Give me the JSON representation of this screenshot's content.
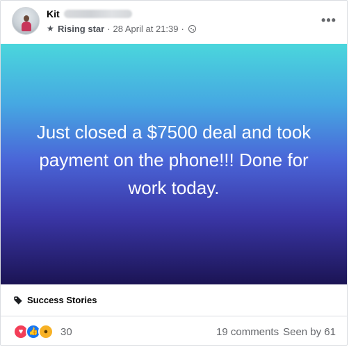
{
  "post": {
    "author": "Kit",
    "badge": "Rising star",
    "timestamp": "28 April at 21:39",
    "separator": "·",
    "more_label": "•••",
    "media_text": "Just closed a $7500 deal and took payment on the phone!!! Done for work today.",
    "topic_tag": "Success Stories",
    "reaction_count": "30",
    "comments": "19 comments",
    "seen_by": "Seen by 61",
    "reactions": [
      "love-icon",
      "like-icon",
      "wow-icon"
    ]
  },
  "colors": {
    "gradient_top": "#4ad6dc",
    "gradient_bottom": "#1b1454",
    "like": "#1877f2",
    "love": "#f33e58",
    "wow": "#f7b125"
  }
}
